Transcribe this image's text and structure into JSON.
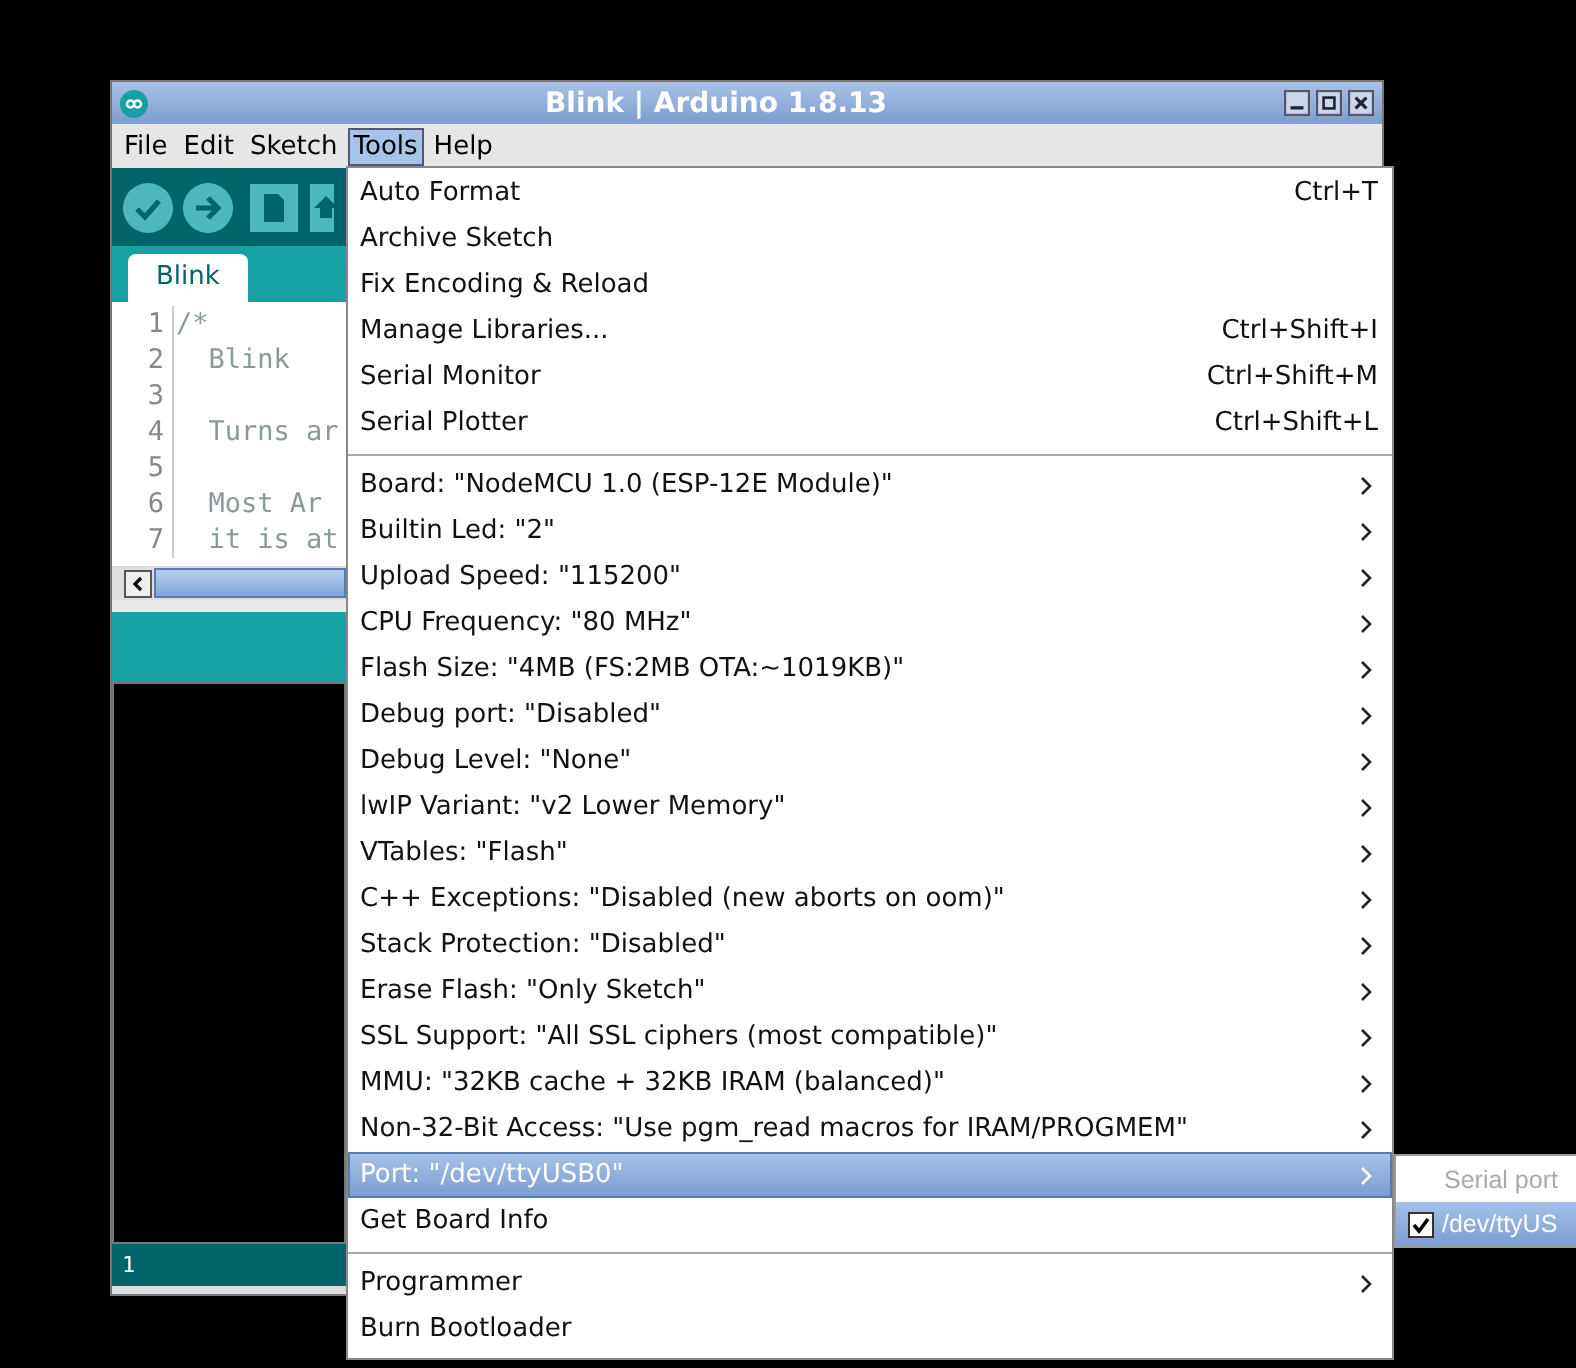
{
  "window": {
    "title": "Blink | Arduino 1.8.13"
  },
  "menubar": [
    {
      "label": "File",
      "selected": false
    },
    {
      "label": "Edit",
      "selected": false
    },
    {
      "label": "Sketch",
      "selected": false
    },
    {
      "label": "Tools",
      "selected": true
    },
    {
      "label": "Help",
      "selected": false
    }
  ],
  "tabs": [
    {
      "label": "Blink",
      "selected": true
    }
  ],
  "editor": {
    "lines": [
      {
        "number": "1",
        "text": "/*"
      },
      {
        "number": "2",
        "text": "  Blink"
      },
      {
        "number": "3"
      },
      {
        "number": "4",
        "text": "  Turns ar"
      },
      {
        "number": "5"
      },
      {
        "number": "6",
        "text": "  Most Ar"
      },
      {
        "number": "7",
        "text": "  it is at"
      }
    ]
  },
  "status_bar": {
    "line": "1"
  },
  "tools_menu": [
    {
      "kind": "item",
      "label": "Auto Format",
      "shortcut": "Ctrl+T",
      "submenu": false,
      "selected": false
    },
    {
      "kind": "item",
      "label": "Archive Sketch",
      "submenu": false,
      "selected": false
    },
    {
      "kind": "item",
      "label": "Fix Encoding & Reload",
      "submenu": false,
      "selected": false
    },
    {
      "kind": "item",
      "label": "Manage Libraries...",
      "shortcut": "Ctrl+Shift+I",
      "submenu": false,
      "selected": false
    },
    {
      "kind": "item",
      "label": "Serial Monitor",
      "shortcut": "Ctrl+Shift+M",
      "submenu": false,
      "selected": false
    },
    {
      "kind": "item",
      "label": "Serial Plotter",
      "shortcut": "Ctrl+Shift+L",
      "submenu": false,
      "selected": false
    },
    {
      "kind": "separator"
    },
    {
      "kind": "item",
      "label": "Board: \"NodeMCU 1.0 (ESP-12E Module)\"",
      "submenu": true,
      "selected": false
    },
    {
      "kind": "item",
      "label": "Builtin Led: \"2\"",
      "submenu": true,
      "selected": false
    },
    {
      "kind": "item",
      "label": "Upload Speed: \"115200\"",
      "submenu": true,
      "selected": false
    },
    {
      "kind": "item",
      "label": "CPU Frequency: \"80 MHz\"",
      "submenu": true,
      "selected": false
    },
    {
      "kind": "item",
      "label": "Flash Size: \"4MB (FS:2MB OTA:~1019KB)\"",
      "submenu": true,
      "selected": false
    },
    {
      "kind": "item",
      "label": "Debug port: \"Disabled\"",
      "submenu": true,
      "selected": false
    },
    {
      "kind": "item",
      "label": "Debug Level: \"None\"",
      "submenu": true,
      "selected": false
    },
    {
      "kind": "item",
      "label": "lwIP Variant: \"v2 Lower Memory\"",
      "submenu": true,
      "selected": false
    },
    {
      "kind": "item",
      "label": "VTables: \"Flash\"",
      "submenu": true,
      "selected": false
    },
    {
      "kind": "item",
      "label": "C++ Exceptions: \"Disabled (new aborts on oom)\"",
      "submenu": true,
      "selected": false
    },
    {
      "kind": "item",
      "label": "Stack Protection: \"Disabled\"",
      "submenu": true,
      "selected": false
    },
    {
      "kind": "item",
      "label": "Erase Flash: \"Only Sketch\"",
      "submenu": true,
      "selected": false
    },
    {
      "kind": "item",
      "label": "SSL Support: \"All SSL ciphers (most compatible)\"",
      "submenu": true,
      "selected": false
    },
    {
      "kind": "item",
      "label": "MMU: \"32KB cache + 32KB IRAM (balanced)\"",
      "submenu": true,
      "selected": false
    },
    {
      "kind": "item",
      "label": "Non-32-Bit Access: \"Use pgm_read macros for IRAM/PROGMEM\"",
      "submenu": true,
      "selected": false
    },
    {
      "kind": "item",
      "label": "Port: \"/dev/ttyUSB0\"",
      "submenu": true,
      "selected": true
    },
    {
      "kind": "item",
      "label": "Get Board Info",
      "submenu": false,
      "selected": false
    },
    {
      "kind": "separator"
    },
    {
      "kind": "item",
      "label": "Programmer",
      "submenu": true,
      "selected": false
    },
    {
      "kind": "item",
      "label": "Burn Bootloader",
      "submenu": false,
      "selected": false
    }
  ],
  "port_submenu": [
    {
      "kind": "header",
      "label": "Serial port",
      "disabled": true
    },
    {
      "kind": "check",
      "label": "/dev/ttyUS",
      "checked": true,
      "selected": true
    }
  ]
}
